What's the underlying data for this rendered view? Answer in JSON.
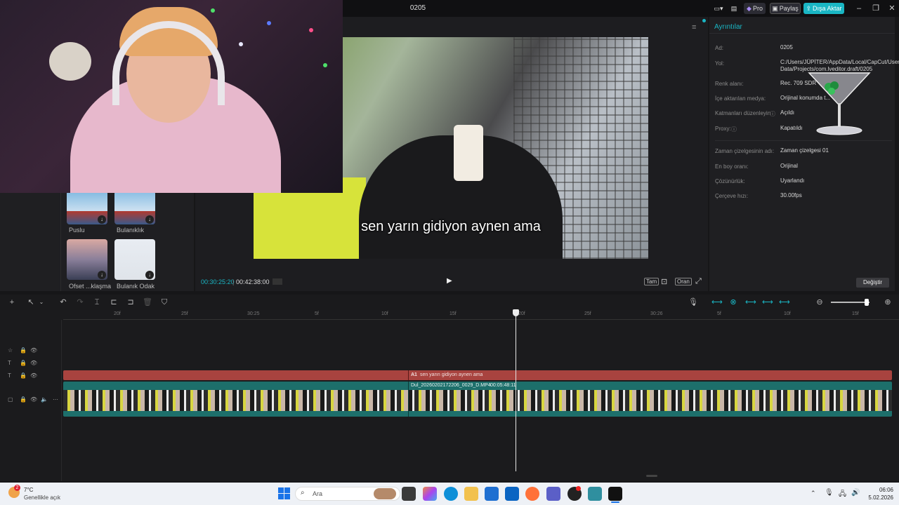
{
  "titlebar": {
    "title": "0205",
    "pro_label": "Pro",
    "share_label": "Paylaş",
    "export_label": "Dışa Aktar"
  },
  "media": {
    "items": [
      {
        "label": "Puslu"
      },
      {
        "label": "Bulanıklık"
      },
      {
        "label": "Ofset ...klaşma"
      },
      {
        "label": "Bulanık Odak"
      }
    ]
  },
  "player": {
    "subtitle": "sen yarın gidiyon aynen ama",
    "current_time": "00:30:25:20",
    "total_time": "00:42:38:00",
    "full_label": "Tam",
    "ratio_label": "Oran"
  },
  "details": {
    "title": "Ayrıntılar",
    "rows": [
      {
        "label": "Ad:",
        "value": "0205"
      },
      {
        "label": "Yol:",
        "value": "C:/Users/JÜPİTER/AppData/Local/CapCut/User Data/Projects/com.lveditor.draft/0205"
      },
      {
        "label": "Renk alanı:",
        "value": "Rec. 709 SDR"
      },
      {
        "label": "İçe aktarılan medya:",
        "value": "Orijinal konumda t..."
      },
      {
        "label": "Katmanları düzenleyin",
        "value": "Açıldı"
      },
      {
        "label": "Proxy:",
        "value": "Kapatıldı"
      },
      {
        "label": "Zaman çizelgesinin adı:",
        "value": "Zaman çizelgesi 01"
      },
      {
        "label": "En boy oranı:",
        "value": "Orijinal"
      },
      {
        "label": "Çözünürlük:",
        "value": "Uyarlandı"
      },
      {
        "label": "Çerçeve hızı:",
        "value": "30.00fps"
      }
    ],
    "change_label": "Değiştir"
  },
  "timeline": {
    "ticks": [
      "20f",
      "25f",
      "30:25",
      "5f",
      "10f",
      "15f",
      "20f",
      "25f",
      "30:26",
      "5f",
      "10f",
      "15f"
    ],
    "text_clip": "sen yarın gidiyon aynen ama",
    "text_clip_prefix": "A1",
    "video_clip_name": "Dul_20260202172206_0029_D.MP4",
    "video_clip_duration": "00:05:48:11"
  },
  "taskbar": {
    "weather_temp": "7°C",
    "weather_desc": "Genellikle açık",
    "weather_badge": "2",
    "search_placeholder": "Ara",
    "time": "06:06",
    "date": "5.02.2026"
  }
}
